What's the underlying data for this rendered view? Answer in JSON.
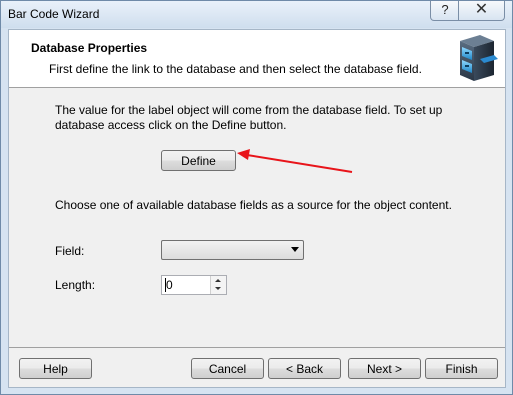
{
  "window": {
    "title": "Bar Code Wizard",
    "help_glyph": "?",
    "close_glyph": "✕"
  },
  "header": {
    "title": "Database Properties",
    "subtitle": "First define the link to the database and then select the database field.",
    "icon": "file-cabinet-icon"
  },
  "body": {
    "description": "The value for the label object will come from the database field. To set up database access click on the Define button.",
    "define_label": "Define",
    "choose_text": "Choose one of available database fields as a source for the object content.",
    "field_label": "Field:",
    "field_value": "",
    "length_label": "Length:",
    "length_value": "0"
  },
  "annotation": {
    "arrow_color": "#e8141a"
  },
  "footer": {
    "help_label": "Help",
    "cancel_label": "Cancel",
    "back_label": "< Back",
    "next_label": "Next >",
    "finish_label": "Finish"
  }
}
